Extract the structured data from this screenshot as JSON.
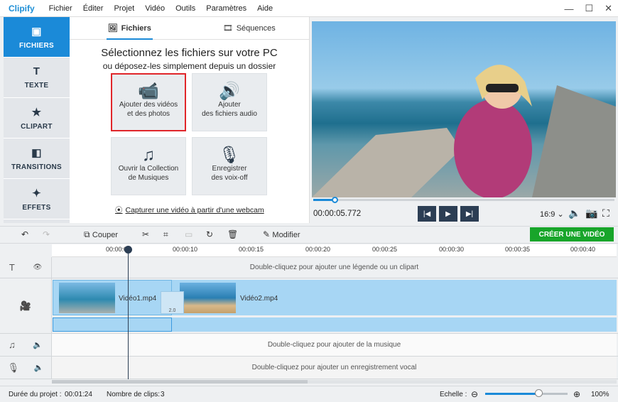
{
  "app": {
    "logo": "Clipify"
  },
  "menu": [
    "Fichier",
    "Éditer",
    "Projet",
    "Vidéo",
    "Outils",
    "Paramètres",
    "Aide"
  ],
  "window_controls": {
    "minimize": "—",
    "maximize": "☐",
    "close": "✕"
  },
  "nav": [
    {
      "label": "FICHIERS",
      "icon": "files-icon",
      "active": true
    },
    {
      "label": "TEXTE",
      "icon": "text-icon",
      "active": false
    },
    {
      "label": "CLIPART",
      "icon": "star-icon",
      "active": false
    },
    {
      "label": "TRANSITIONS",
      "icon": "transitions-icon",
      "active": false
    },
    {
      "label": "EFFETS",
      "icon": "magic-wand-icon",
      "active": false
    }
  ],
  "tabs": [
    {
      "label": "Fichiers",
      "icon": "image-icon"
    },
    {
      "label": "Séquences",
      "icon": "film-icon"
    }
  ],
  "panel": {
    "title": "Sélectionnez les fichiers sur votre PC",
    "subtitle": "ou déposez-les simplement depuis un dossier",
    "tiles": [
      {
        "line1": "Ajouter des vidéos",
        "line2": "et des photos",
        "icon": "video-photo-icon"
      },
      {
        "line1": "Ajouter",
        "line2": "des fichiers audio",
        "icon": "audio-file-icon"
      },
      {
        "line1": "Ouvrir la Collection",
        "line2": "de Musiques",
        "icon": "music-notes-icon"
      },
      {
        "line1": "Enregistrer",
        "line2": "des voix-off",
        "icon": "microphone-icon"
      }
    ],
    "webcam": "Capturer une vidéo à partir d'une webcam"
  },
  "player": {
    "timecode": "00:00:05.772",
    "ratio": "16:9",
    "progress": 0.07
  },
  "toolbar": {
    "cut": "Couper",
    "modify": "Modifier",
    "create": "CRÉER UNE VIDÉO"
  },
  "ruler": [
    "00:00:05",
    "00:00:10",
    "00:00:15",
    "00:00:20",
    "00:00:25",
    "00:00:30",
    "00:00:35",
    "00:00:40"
  ],
  "tracks": {
    "caption": "Double-cliquez pour ajouter une légende ou un clipart",
    "clip1": "Vidéo1.mp4",
    "clip2": "Vidéo2.mp4",
    "transition": "2.0",
    "music": "Double-cliquez pour ajouter de la musique",
    "voice": "Double-cliquez pour ajouter un enregistrement vocal"
  },
  "status": {
    "duration_label": "Durée du projet :",
    "duration": "00:01:24",
    "clips_label": "Nombre de clips:",
    "clips": "3",
    "scale_label": "Echelle :",
    "zoom": "100%",
    "zoom_level": 0.65
  }
}
